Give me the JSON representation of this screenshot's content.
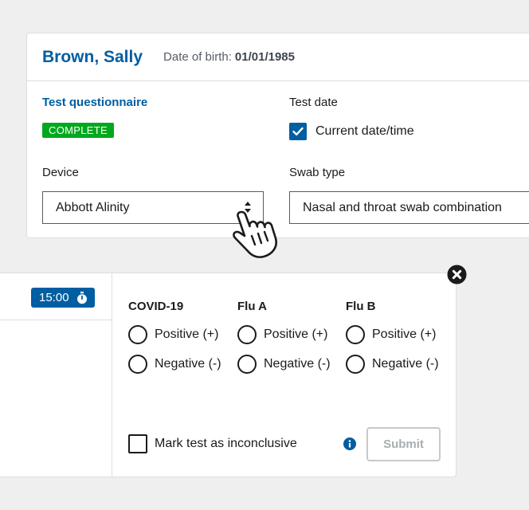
{
  "patient": {
    "name": "Brown, Sally",
    "dob_label": "Date of birth:",
    "dob_value": "01/01/1985"
  },
  "questionnaire": {
    "link_label": "Test questionnaire",
    "status_badge": "COMPLETE"
  },
  "test_date": {
    "label": "Test date",
    "current_checkbox_label": "Current date/time",
    "current_checked": true
  },
  "device": {
    "label": "Device",
    "selected": "Abbott Alinity"
  },
  "swab_type": {
    "label": "Swab type",
    "selected": "Nasal and throat swab combination"
  },
  "timer": {
    "value": "15:00",
    "icon": "stopwatch-icon"
  },
  "results": [
    {
      "heading": "COVID-19",
      "positive_label": "Positive (+)",
      "negative_label": "Negative (-)"
    },
    {
      "heading": "Flu A",
      "positive_label": "Positive (+)",
      "negative_label": "Negative (-)"
    },
    {
      "heading": "Flu B",
      "positive_label": "Positive (+)",
      "negative_label": "Negative (-)"
    }
  ],
  "inconclusive": {
    "label": "Mark test as inconclusive",
    "checked": false
  },
  "submit": {
    "label": "Submit"
  },
  "icons": {
    "close": "close-circle-icon",
    "info": "info-icon",
    "cursor": "pointer-hand-icon",
    "select_arrows": "sort-arrows-icon",
    "check": "check-icon"
  },
  "colors": {
    "primary_blue": "#005ea2",
    "success_green": "#00a91c",
    "disabled_gray": "#a9aeb1",
    "text": "#1b1b1b"
  }
}
